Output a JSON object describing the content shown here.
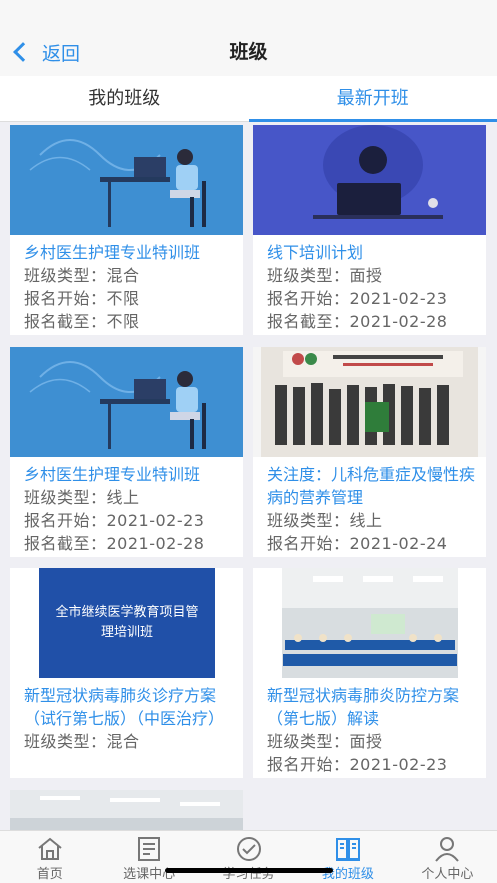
{
  "header": {
    "back_label": "返回",
    "title": "班级"
  },
  "tabs": [
    {
      "label": "我的班级"
    },
    {
      "label": "最新开班"
    }
  ],
  "cards": [
    {
      "title": "乡村医生护理专业特训班",
      "lines": [
        "班级类型：混合",
        "报名开始：不限",
        "报名截至：不限"
      ]
    },
    {
      "title": "线下培训计划",
      "lines": [
        "班级类型：面授",
        "报名开始：2021-02-23",
        "报名截至：2021-02-28"
      ]
    },
    {
      "title": "乡村医生护理专业特训班",
      "lines": [
        "班级类型：线上",
        "报名开始：2021-02-23",
        "报名截至：2021-02-28"
      ]
    },
    {
      "title": "关注度：儿科危重症及慢性疾病的营养管理",
      "lines": [
        "班级类型：线上",
        "报名开始：2021-02-24"
      ]
    },
    {
      "title": "新型冠状病毒肺炎诊疗方案（试行第七版）（中医治疗）",
      "lines": [
        "班级类型：混合"
      ],
      "banner_text": "全市继续医学教育项目管理培训班"
    },
    {
      "title": "新型冠状病毒肺炎防控方案（第七版）解读",
      "lines": [
        "班级类型：面授",
        "报名开始：2021-02-23"
      ]
    }
  ],
  "tabbar": [
    {
      "label": "首页",
      "icon": "home-icon"
    },
    {
      "label": "选课中心",
      "icon": "course-list-icon"
    },
    {
      "label": "学习任务",
      "icon": "check-circle-icon"
    },
    {
      "label": "我的班级",
      "icon": "class-icon"
    },
    {
      "label": "个人中心",
      "icon": "person-icon"
    }
  ],
  "colors": {
    "accent": "#2f8fe8",
    "background": "#efeff4"
  }
}
